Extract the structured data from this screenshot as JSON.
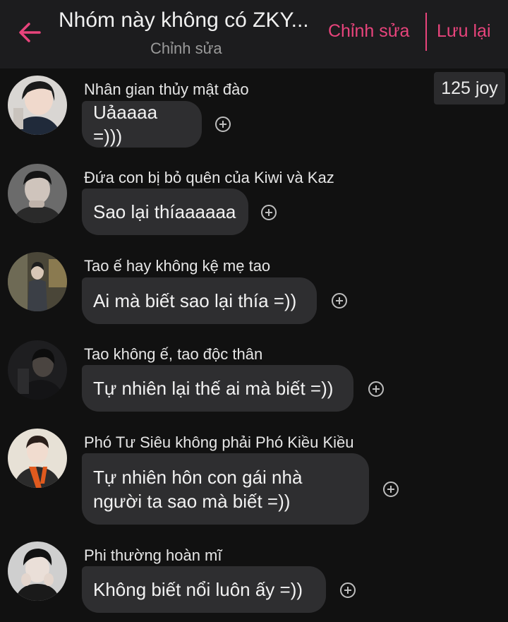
{
  "header": {
    "title": "Nhóm này không có ZKY...",
    "subtitle": "Chỉnh sửa",
    "edit_label": "Chỉnh sửa",
    "save_label": "Lưu lại",
    "back_icon": "arrow-left-icon",
    "accent_color": "#e8447c"
  },
  "joy_badge": "125 joy",
  "messages": [
    {
      "sender": "Nhân gian thủy mật đào",
      "text": "Uảaaaa =)))"
    },
    {
      "sender": "Đứa con bị bỏ quên của Kiwi và Kaz",
      "text": "Sao lại thíaaaaaa"
    },
    {
      "sender": "Tao ế hay không kệ mẹ tao",
      "text": "Ai mà biết sao lại thía =))"
    },
    {
      "sender": "Tao không ế, tao độc thân",
      "text": "Tự nhiên lại thế ai mà biết =))"
    },
    {
      "sender": "Phó Tư Siêu không phải Phó Kiều Kiều",
      "text_line1": "Tự nhiên hôn con gái nhà",
      "text_line2": "người ta sao mà biết =))"
    },
    {
      "sender": "Phi thường hoàn mĩ",
      "text": "Không biết nổi luôn ấy =))"
    }
  ]
}
